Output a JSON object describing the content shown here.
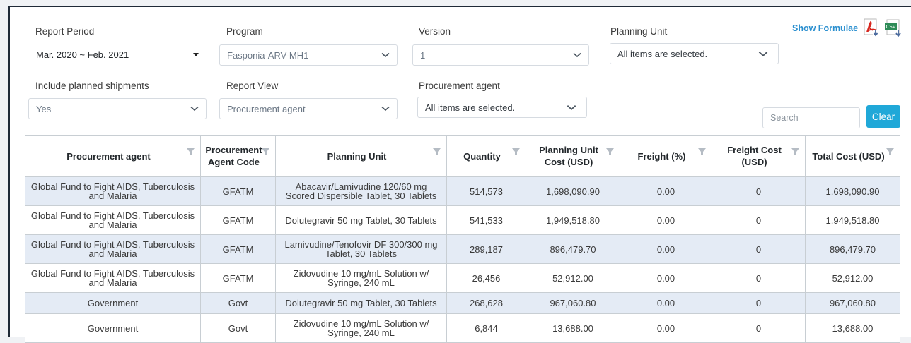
{
  "filters": {
    "report_period": {
      "label": "Report Period",
      "value": "Mar. 2020 ~ Feb. 2021"
    },
    "program": {
      "label": "Program",
      "value": "Fasponia-ARV-MH1"
    },
    "version": {
      "label": "Version",
      "value": "1"
    },
    "planning_unit": {
      "label": "Planning Unit",
      "value": "All items are selected."
    },
    "include_planned": {
      "label": "Include planned shipments",
      "value": "Yes"
    },
    "report_view": {
      "label": "Report View",
      "value": "Procurement agent"
    },
    "procurement_agent": {
      "label": "Procurement agent",
      "value": "All items are selected."
    }
  },
  "toolbar": {
    "show_formulae": "Show Formulae",
    "pdf_icon": "pdf-icon",
    "csv_icon": "csv-icon",
    "csv_text": "CSV"
  },
  "search": {
    "placeholder": "Search"
  },
  "clear_label": "Clear",
  "table": {
    "headers": [
      "Procurement agent",
      "Procurement Agent Code",
      "Planning Unit",
      "Quantity",
      "Planning Unit Cost (USD)",
      "Freight (%)",
      "Freight Cost (USD)",
      "Total Cost (USD)"
    ],
    "rows": [
      [
        "Global Fund to Fight AIDS, Tuberculosis and Malaria",
        "GFATM",
        "Abacavir/Lamivudine 120/60 mg Scored Dispersible Tablet, 30 Tablets",
        "514,573",
        "1,698,090.90",
        "0.00",
        "0",
        "1,698,090.90"
      ],
      [
        "Global Fund to Fight AIDS, Tuberculosis and Malaria",
        "GFATM",
        "Dolutegravir 50 mg Tablet, 30 Tablets",
        "541,533",
        "1,949,518.80",
        "0.00",
        "0",
        "1,949,518.80"
      ],
      [
        "Global Fund to Fight AIDS, Tuberculosis and Malaria",
        "GFATM",
        "Lamivudine/Tenofovir DF 300/300 mg Tablet, 30 Tablets",
        "289,187",
        "896,479.70",
        "0.00",
        "0",
        "896,479.70"
      ],
      [
        "Global Fund to Fight AIDS, Tuberculosis and Malaria",
        "GFATM",
        "Zidovudine 10 mg/mL Solution w/ Syringe, 240 mL",
        "26,456",
        "52,912.00",
        "0.00",
        "0",
        "52,912.00"
      ],
      [
        "Government",
        "Govt",
        "Dolutegravir 50 mg Tablet, 30 Tablets",
        "268,628",
        "967,060.80",
        "0.00",
        "0",
        "967,060.80"
      ],
      [
        "Government",
        "Govt",
        "Zidovudine 10 mg/mL Solution w/ Syringe, 240 mL",
        "6,844",
        "13,688.00",
        "0.00",
        "0",
        "13,688.00"
      ]
    ]
  },
  "colors": {
    "accent": "#20a8d8",
    "row_alt": "#e4ebf5",
    "link": "#2a8fcf"
  }
}
